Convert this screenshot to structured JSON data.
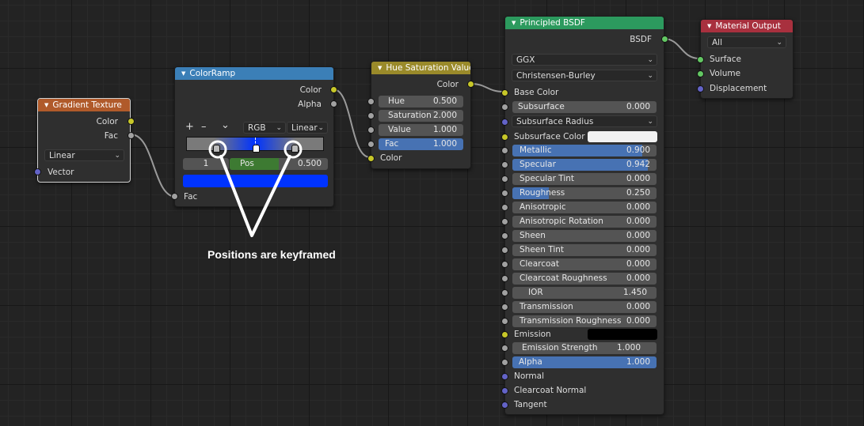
{
  "nodes": {
    "gradient_texture": {
      "title": "Gradient Texture",
      "outputs": [
        "Color",
        "Fac"
      ],
      "type_value": "Linear",
      "input": "Vector",
      "header_color": "#b05a2a"
    },
    "color_ramp": {
      "title": "ColorRamp",
      "outputs": [
        "Color",
        "Alpha"
      ],
      "add": "+",
      "remove": "–",
      "menu": "⌄",
      "color_mode": "RGB",
      "interpolation": "Linear",
      "stop_index": "1",
      "pos_label": "Pos",
      "pos_value": "0.500",
      "input": "Fac",
      "header_color": "#3b7fb7",
      "selected_color": "#0033ff",
      "stops": [
        0.2,
        0.5,
        0.8
      ]
    },
    "hue_saturation_value": {
      "title": "Hue Saturation Value",
      "output": "Color",
      "fields": [
        {
          "label": "Hue",
          "value": "0.500"
        },
        {
          "label": "Saturation",
          "value": "2.000"
        },
        {
          "label": "Value",
          "value": "1.000"
        },
        {
          "label": "Fac",
          "value": "1.000"
        }
      ],
      "input": "Color",
      "header_color": "#9a8a2a"
    },
    "principled_bsdf": {
      "title": "Principled BSDF",
      "output": "BSDF",
      "distribution": "GGX",
      "subsurface_method": "Christensen-Burley",
      "base_color": "Base Color",
      "subsurface": {
        "label": "Subsurface",
        "value": "0.000"
      },
      "subsurface_radius": "Subsurface Radius",
      "subsurface_color": "Subsurface Color",
      "fields": [
        {
          "label": "Metallic",
          "value": "0.900",
          "fill": 0.9
        },
        {
          "label": "Specular",
          "value": "0.942",
          "fill": 0.942
        },
        {
          "label": "Specular Tint",
          "value": "0.000",
          "fill": 0
        },
        {
          "label": "Roughness",
          "value": "0.250",
          "fill": 0.25
        },
        {
          "label": "Anisotropic",
          "value": "0.000",
          "fill": 0
        },
        {
          "label": "Anisotropic Rotation",
          "value": "0.000",
          "fill": 0
        },
        {
          "label": "Sheen",
          "value": "0.000",
          "fill": 0
        },
        {
          "label": "Sheen Tint",
          "value": "0.000",
          "fill": 0
        },
        {
          "label": "Clearcoat",
          "value": "0.000",
          "fill": 0
        },
        {
          "label": "Clearcoat Roughness",
          "value": "0.000",
          "fill": 0
        },
        {
          "label": "IOR",
          "value": "1.450",
          "fill": 0
        },
        {
          "label": "Transmission",
          "value": "0.000",
          "fill": 0
        },
        {
          "label": "Transmission Roughness",
          "value": "0.000",
          "fill": 0
        }
      ],
      "emission": "Emission",
      "emission_strength": {
        "label": "Emission Strength",
        "value": "1.000"
      },
      "alpha": {
        "label": "Alpha",
        "value": "1.000"
      },
      "inputs_tail": [
        "Normal",
        "Clearcoat Normal",
        "Tangent"
      ],
      "header_color": "#2c9a5e"
    },
    "material_output": {
      "title": "Material Output",
      "target": "All",
      "inputs": [
        "Surface",
        "Volume",
        "Displacement"
      ],
      "header_color": "#a8303e"
    }
  },
  "annotation": "Positions are keyframed"
}
